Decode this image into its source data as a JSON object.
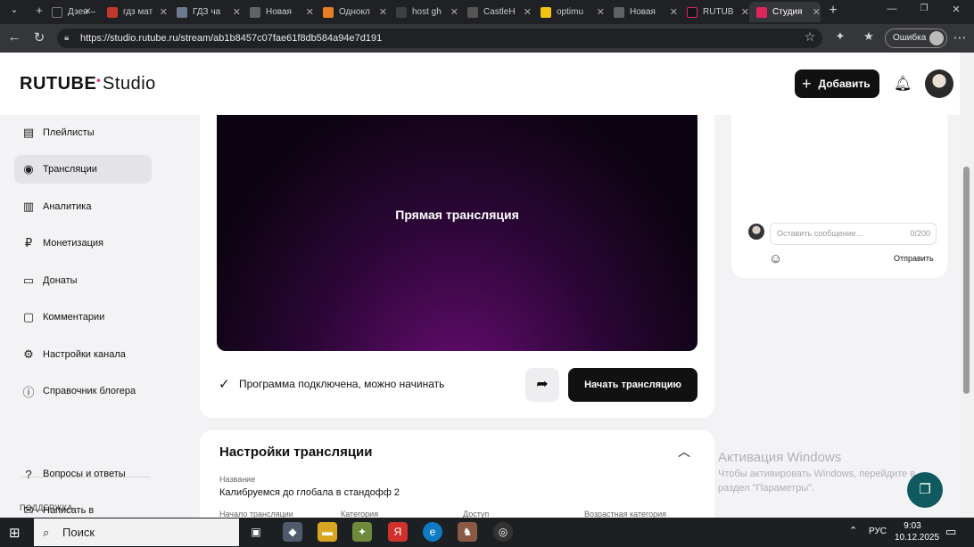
{
  "browser": {
    "tabs": [
      {
        "title": "Дзен –",
        "color": "#202124"
      },
      {
        "title": "гдз мат",
        "color": "#c0392b"
      },
      {
        "title": "ГДЗ ча",
        "color": "#6b7a8f"
      },
      {
        "title": "Новая",
        "color": "#5f6368"
      },
      {
        "title": "Однокл",
        "color": "#e67e22"
      },
      {
        "title": "host gh",
        "color": "#3c4043"
      },
      {
        "title": "CastleH",
        "color": "#555555"
      },
      {
        "title": "optimu",
        "color": "#f1c40f"
      },
      {
        "title": "Новая",
        "color": "#5f6368"
      },
      {
        "title": "RUTUB",
        "color": "#14151a"
      },
      {
        "title": "Студия",
        "color": "#e0245e"
      }
    ],
    "url": "https://studio.rutube.ru/stream/ab1b8457c07fae61f8db584a94e7d191",
    "error_label": "Ошибка"
  },
  "header": {
    "logo_main": "RUTUBE",
    "logo_studio": "Studio",
    "add_label": "Добавить"
  },
  "sidebar": {
    "items": [
      {
        "label": "Плейлисты",
        "icon": "playlist-icon"
      },
      {
        "label": "Трансляции",
        "icon": "broadcast-icon"
      },
      {
        "label": "Аналитика",
        "icon": "analytics-icon"
      },
      {
        "label": "Монетизация",
        "icon": "monetization-icon"
      },
      {
        "label": "Донаты",
        "icon": "donations-icon"
      },
      {
        "label": "Комментарии",
        "icon": "comments-icon"
      },
      {
        "label": "Настройки канала",
        "icon": "gear-icon"
      },
      {
        "label": "Справочник блогера",
        "icon": "info-icon"
      }
    ],
    "support_heading": "ПОДДЕРЖКА",
    "support_items": [
      {
        "label": "Вопросы и ответы",
        "icon": "question-icon"
      },
      {
        "label": "Написать в",
        "icon": "message-icon"
      }
    ]
  },
  "player": {
    "title": "Прямая трансляция"
  },
  "stream_status": {
    "text": "Программа подключена, можно начинать",
    "start_label": "Начать трансляцию"
  },
  "settings": {
    "title": "Настройки трансляции",
    "name_label": "Название",
    "name_value": "Калибруемся до глобала в стандофф 2",
    "meta_labels": [
      "Начало трансляции",
      "Категория",
      "Доступ",
      "Возрастная категория"
    ]
  },
  "chat": {
    "placeholder": "Оставить сообщение...",
    "counter": "0/200",
    "send_label": "Отправить"
  },
  "watermark": {
    "title": "Активация Windows",
    "subtitle": "Чтобы активировать Windows, перейдите в раздел \"Параметры\"."
  },
  "taskbar": {
    "search_label": "Поиск",
    "language": "РУС",
    "time": "9:03",
    "date": "10.12.2025"
  }
}
